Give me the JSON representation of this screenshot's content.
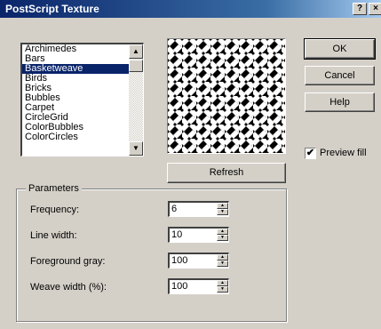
{
  "window": {
    "title": "PostScript Texture",
    "help_glyph": "?",
    "close_glyph": "×"
  },
  "texture_list": {
    "items": [
      "Archimedes",
      "Bars",
      "Basketweave",
      "Birds",
      "Bricks",
      "Bubbles",
      "Carpet",
      "CircleGrid",
      "ColorBubbles",
      "ColorCircles"
    ],
    "selected": "Basketweave"
  },
  "buttons": {
    "ok": "OK",
    "cancel": "Cancel",
    "help": "Help",
    "refresh": "Refresh"
  },
  "preview_fill": {
    "label": "Preview fill",
    "checked": true,
    "check_glyph": "✔"
  },
  "parameters": {
    "title": "Parameters",
    "fields": [
      {
        "label": "Frequency:",
        "value": "6"
      },
      {
        "label": "Line width:",
        "value": "10"
      },
      {
        "label": "Foreground gray:",
        "value": "100"
      },
      {
        "label": "Weave width (%):",
        "value": "100"
      }
    ]
  },
  "icons": {
    "scroll_up": "up-arrow-icon",
    "scroll_down": "down-arrow-icon",
    "spin_up": "spin-up-icon",
    "spin_down": "spin-down-icon"
  }
}
